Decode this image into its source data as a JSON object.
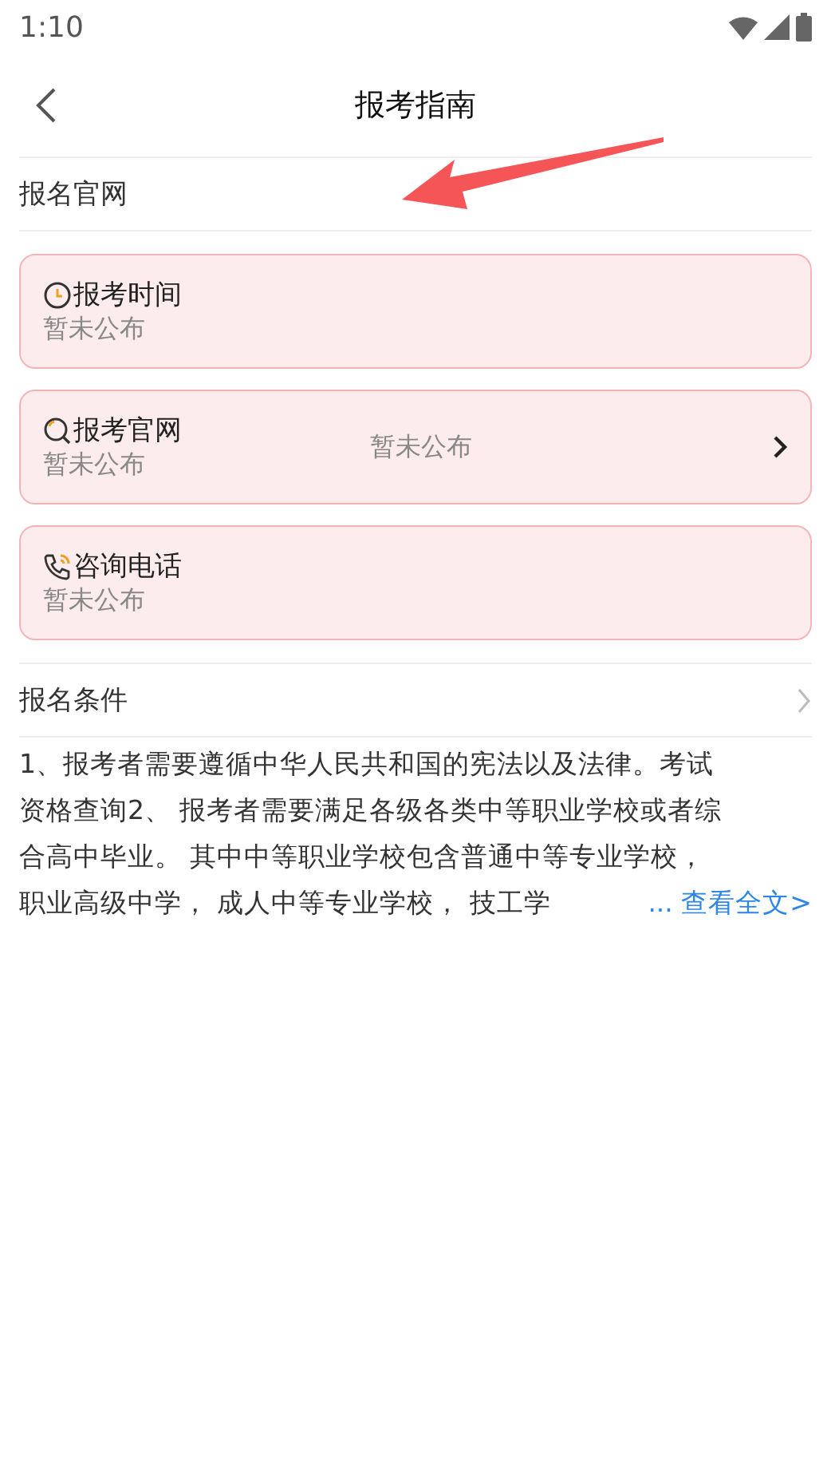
{
  "status_bar": {
    "time": "1:10"
  },
  "header": {
    "title": "报考指南"
  },
  "section_1": {
    "title": "报名官网"
  },
  "cards": [
    {
      "kind": "plain",
      "title": "报考时间",
      "value": "暂未公布"
    },
    {
      "kind": "link",
      "title": "报考官网",
      "value": "暂未公布",
      "middle": "暂未公布"
    },
    {
      "kind": "plain",
      "title": "咨询电话",
      "value": "暂未公布"
    }
  ],
  "section_2": {
    "title": "报名条件"
  },
  "conditions": {
    "lines": [
      "1、报考者需要遵循中华人民共和国的宪法以及法律。考试",
      "资格查询2、 报考者需要满足各级各类中等职业学校或者综",
      "合高中毕业。 其中中等职业学校包含普通中等专业学校，",
      "职业高级中学， 成人中等专业学校， 技工学"
    ],
    "more": "... 查看全文>"
  }
}
